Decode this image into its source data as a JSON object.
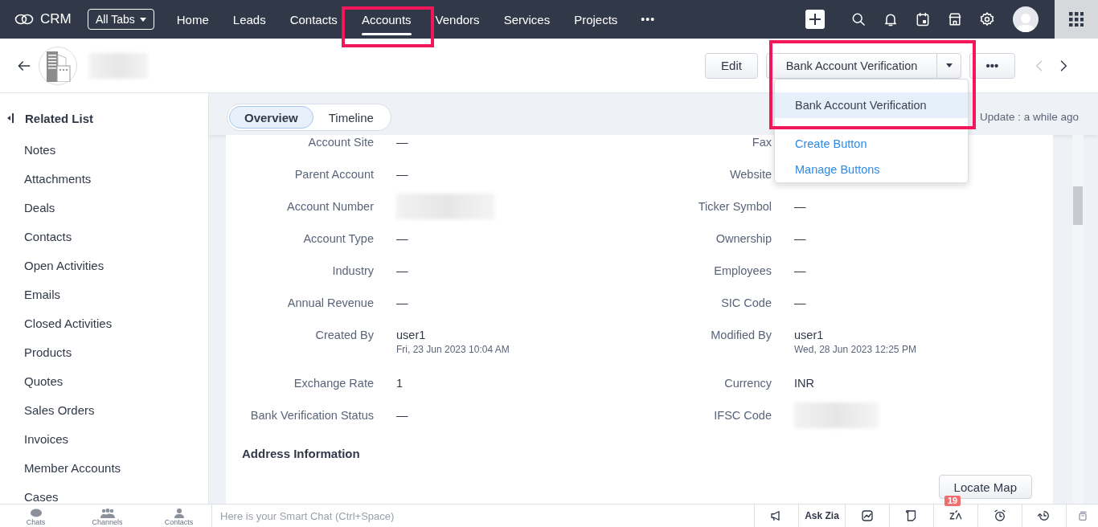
{
  "nav": {
    "logo": "CRM",
    "all_tabs": "All Tabs",
    "more": "•••",
    "tabs": [
      {
        "label": "Home",
        "selected": false
      },
      {
        "label": "Leads",
        "selected": false
      },
      {
        "label": "Contacts",
        "selected": false
      },
      {
        "label": "Accounts",
        "selected": true
      },
      {
        "label": "Vendors",
        "selected": false
      },
      {
        "label": "Services",
        "selected": false
      },
      {
        "label": "Projects",
        "selected": false
      }
    ]
  },
  "record_header": {
    "edit": "Edit",
    "custom_button": "Bank Account Verification",
    "more": "•••",
    "menu": [
      {
        "label": "Bank Account Verification",
        "kind": "option",
        "selected": true
      },
      {
        "label": "Create Button",
        "kind": "link",
        "selected": false
      },
      {
        "label": "Manage Buttons",
        "kind": "link",
        "selected": false
      }
    ]
  },
  "sidebar": {
    "title": "Related List",
    "items": [
      "Notes",
      "Attachments",
      "Deals",
      "Contacts",
      "Open Activities",
      "Emails",
      "Closed Activities",
      "Products",
      "Quotes",
      "Sales Orders",
      "Invoices",
      "Member Accounts",
      "Cases"
    ]
  },
  "view_tabs": [
    {
      "label": "Overview",
      "selected": true
    },
    {
      "label": "Timeline",
      "selected": false
    }
  ],
  "last_update": "Update : a while ago",
  "field_rows": [
    [
      {
        "label": "Account Site",
        "value": "—"
      },
      {
        "label": "Fax"
      }
    ],
    [
      {
        "label": "Parent Account",
        "value": "—"
      },
      {
        "label": "Website"
      }
    ],
    [
      {
        "label": "Account Number",
        "kind": "blurred"
      },
      {
        "label": "Ticker Symbol",
        "value": "—"
      }
    ],
    [
      {
        "label": "Account Type",
        "value": "—"
      },
      {
        "label": "Ownership",
        "value": "—"
      }
    ],
    [
      {
        "label": "Industry",
        "value": "—"
      },
      {
        "label": "Employees",
        "value": "—"
      }
    ],
    [
      {
        "label": "Annual Revenue",
        "value": "—"
      },
      {
        "label": "SIC Code",
        "value": "—"
      }
    ],
    [
      {
        "label": "Created By",
        "value": "user1",
        "sub": "Fri, 23 Jun 2023 10:04 AM"
      },
      {
        "label": "Modified By",
        "value": "user1",
        "sub": "Wed, 28 Jun 2023 12:25 PM"
      }
    ],
    [
      {
        "label": "Exchange Rate",
        "value": "1"
      },
      {
        "label": "Currency",
        "value": "INR"
      }
    ],
    [
      {
        "label": "Bank Verification Status",
        "value": "—"
      },
      {
        "label": "IFSC Code",
        "kind": "blurred"
      }
    ]
  ],
  "section_title": "Address Information",
  "locate_map": "Locate Map",
  "bottom_bar": {
    "apps": [
      {
        "label": "Chats",
        "kind": "chat"
      },
      {
        "label": "Channels",
        "kind": "group"
      },
      {
        "label": "Contacts",
        "kind": "person"
      }
    ],
    "chat_placeholder": "Here is your Smart Chat (Ctrl+Space)",
    "ask_zia": "Ask Zia",
    "badge": "19"
  }
}
